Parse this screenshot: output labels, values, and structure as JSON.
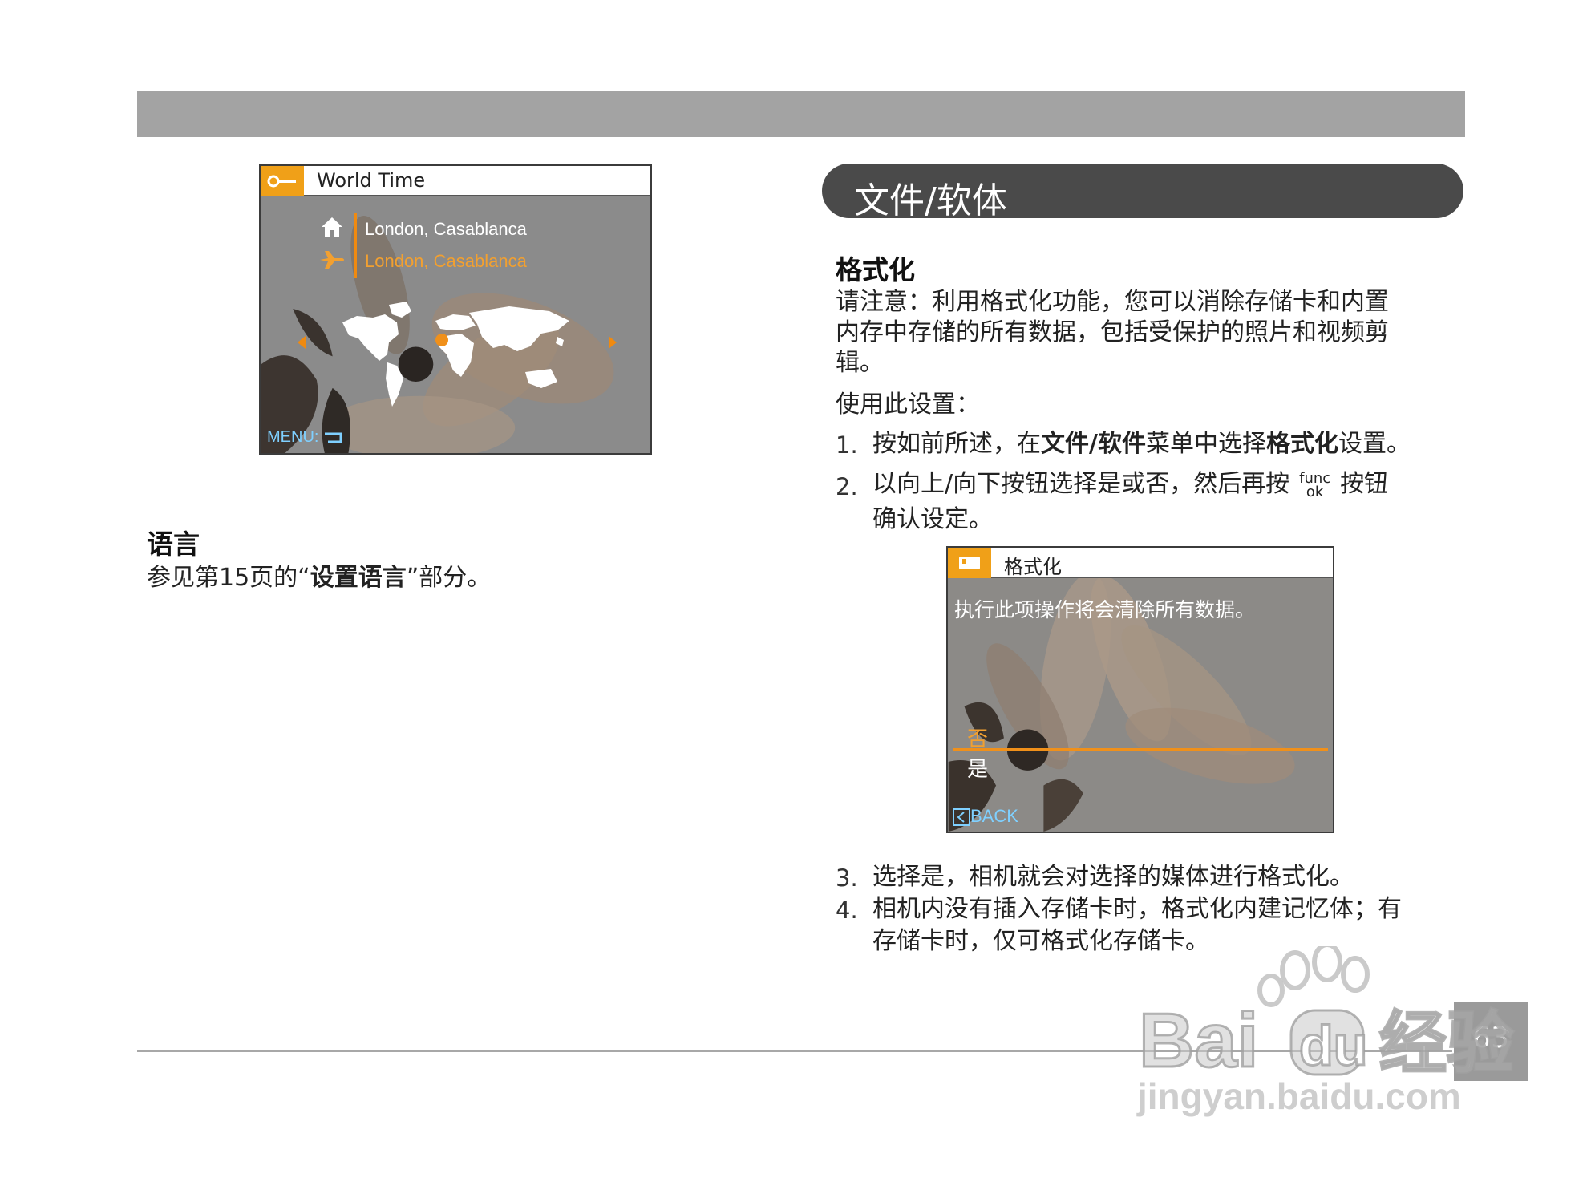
{
  "world_time_screen": {
    "title": "World Time",
    "home_city": "London, Casablanca",
    "destination_city": "London, Casablanca",
    "menu_label": "MENU:"
  },
  "left": {
    "heading": "语言",
    "text_before": "参见第15页的“",
    "text_bold": "设置语言",
    "text_after": "”部分。"
  },
  "right": {
    "section_title": "文件/软体",
    "subheading": "格式化",
    "note_line1": "请注意：利用格式化功能，您可以消除存储卡和内置",
    "note_line2": "内存中存储的所有数据，包括受保护的照片和视频剪",
    "note_line3": "辑。",
    "usage": "使用此设置：",
    "steps": [
      {
        "num": "1.",
        "parts": [
          "按如前所述，在",
          "文件/软件",
          "菜单中选择",
          "格式化",
          "设置。"
        ]
      },
      {
        "num": "2.",
        "line1_before": "以向上/向下按钮选择是或否，然后再按",
        "func": "func",
        "ok": "ok",
        "line1_after": "按钮",
        "line2": "确认设定。"
      },
      {
        "num": "3.",
        "text": "选择是，相机就会对选择的媒体进行格式化。"
      },
      {
        "num": "4.",
        "line1": "相机内没有插入存储卡时，格式化内建记忆体；有",
        "line2": "存储卡时，仅可格式化存储卡。"
      }
    ]
  },
  "format_screen": {
    "title": "格式化",
    "message": "执行此项操作将会清除所有数据。",
    "option_no": "否",
    "option_yes": "是",
    "back_label": "BACK"
  },
  "page_number": "63",
  "watermark": {
    "text": "jingyan.baidu.com"
  }
}
